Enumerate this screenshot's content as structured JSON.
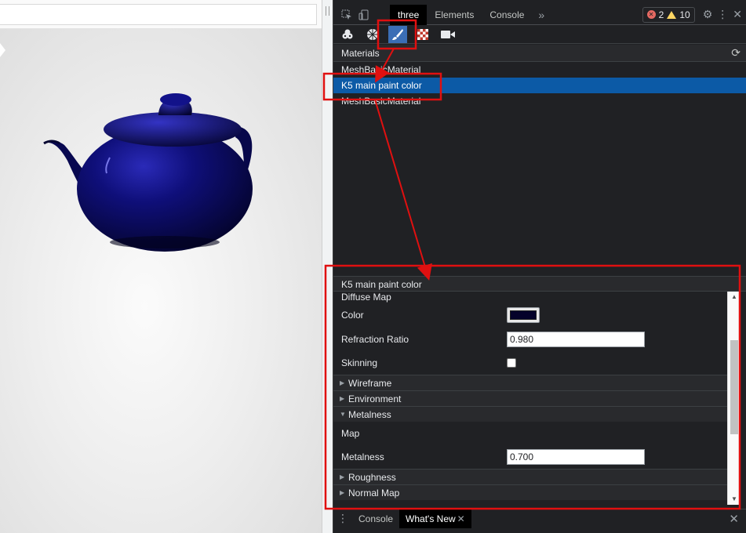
{
  "devtools": {
    "tabs": [
      "three",
      "Elements",
      "Console"
    ],
    "active_tab": "three",
    "more_tabs": "»",
    "errors_count": "2",
    "warnings_count": "10",
    "toolbar_tools": [
      "scene-icon",
      "geometry-icon",
      "material-brush-icon",
      "texture-checker-icon",
      "camera-icon"
    ],
    "active_tool": "material-brush-icon"
  },
  "materials_panel": {
    "title": "Materials",
    "items": [
      "MeshBasicMaterial",
      "K5 main paint color",
      "MeshBasicMaterial"
    ],
    "selected_index": 1
  },
  "material_detail": {
    "title": "K5 main paint color",
    "diffuse_map_label": "Diffuse Map",
    "color_label": "Color",
    "color_value_hex": "#05022a",
    "refraction_label": "Refraction Ratio",
    "refraction_value": "0.980",
    "skinning_label": "Skinning",
    "skinning_checked": false,
    "sections": {
      "wireframe": "Wireframe",
      "environment": "Environment",
      "metalness": "Metalness",
      "roughness": "Roughness",
      "normal_map": "Normal Map"
    },
    "metalness_map_label": "Map",
    "metalness_label": "Metalness",
    "metalness_value": "0.700"
  },
  "drawer": {
    "tabs": [
      "Console",
      "What's New"
    ],
    "active_tab": "What's New"
  },
  "colors": {
    "teapot": "#0a0a5a",
    "selection": "#0c5aa6",
    "annotation": "#e01010"
  }
}
